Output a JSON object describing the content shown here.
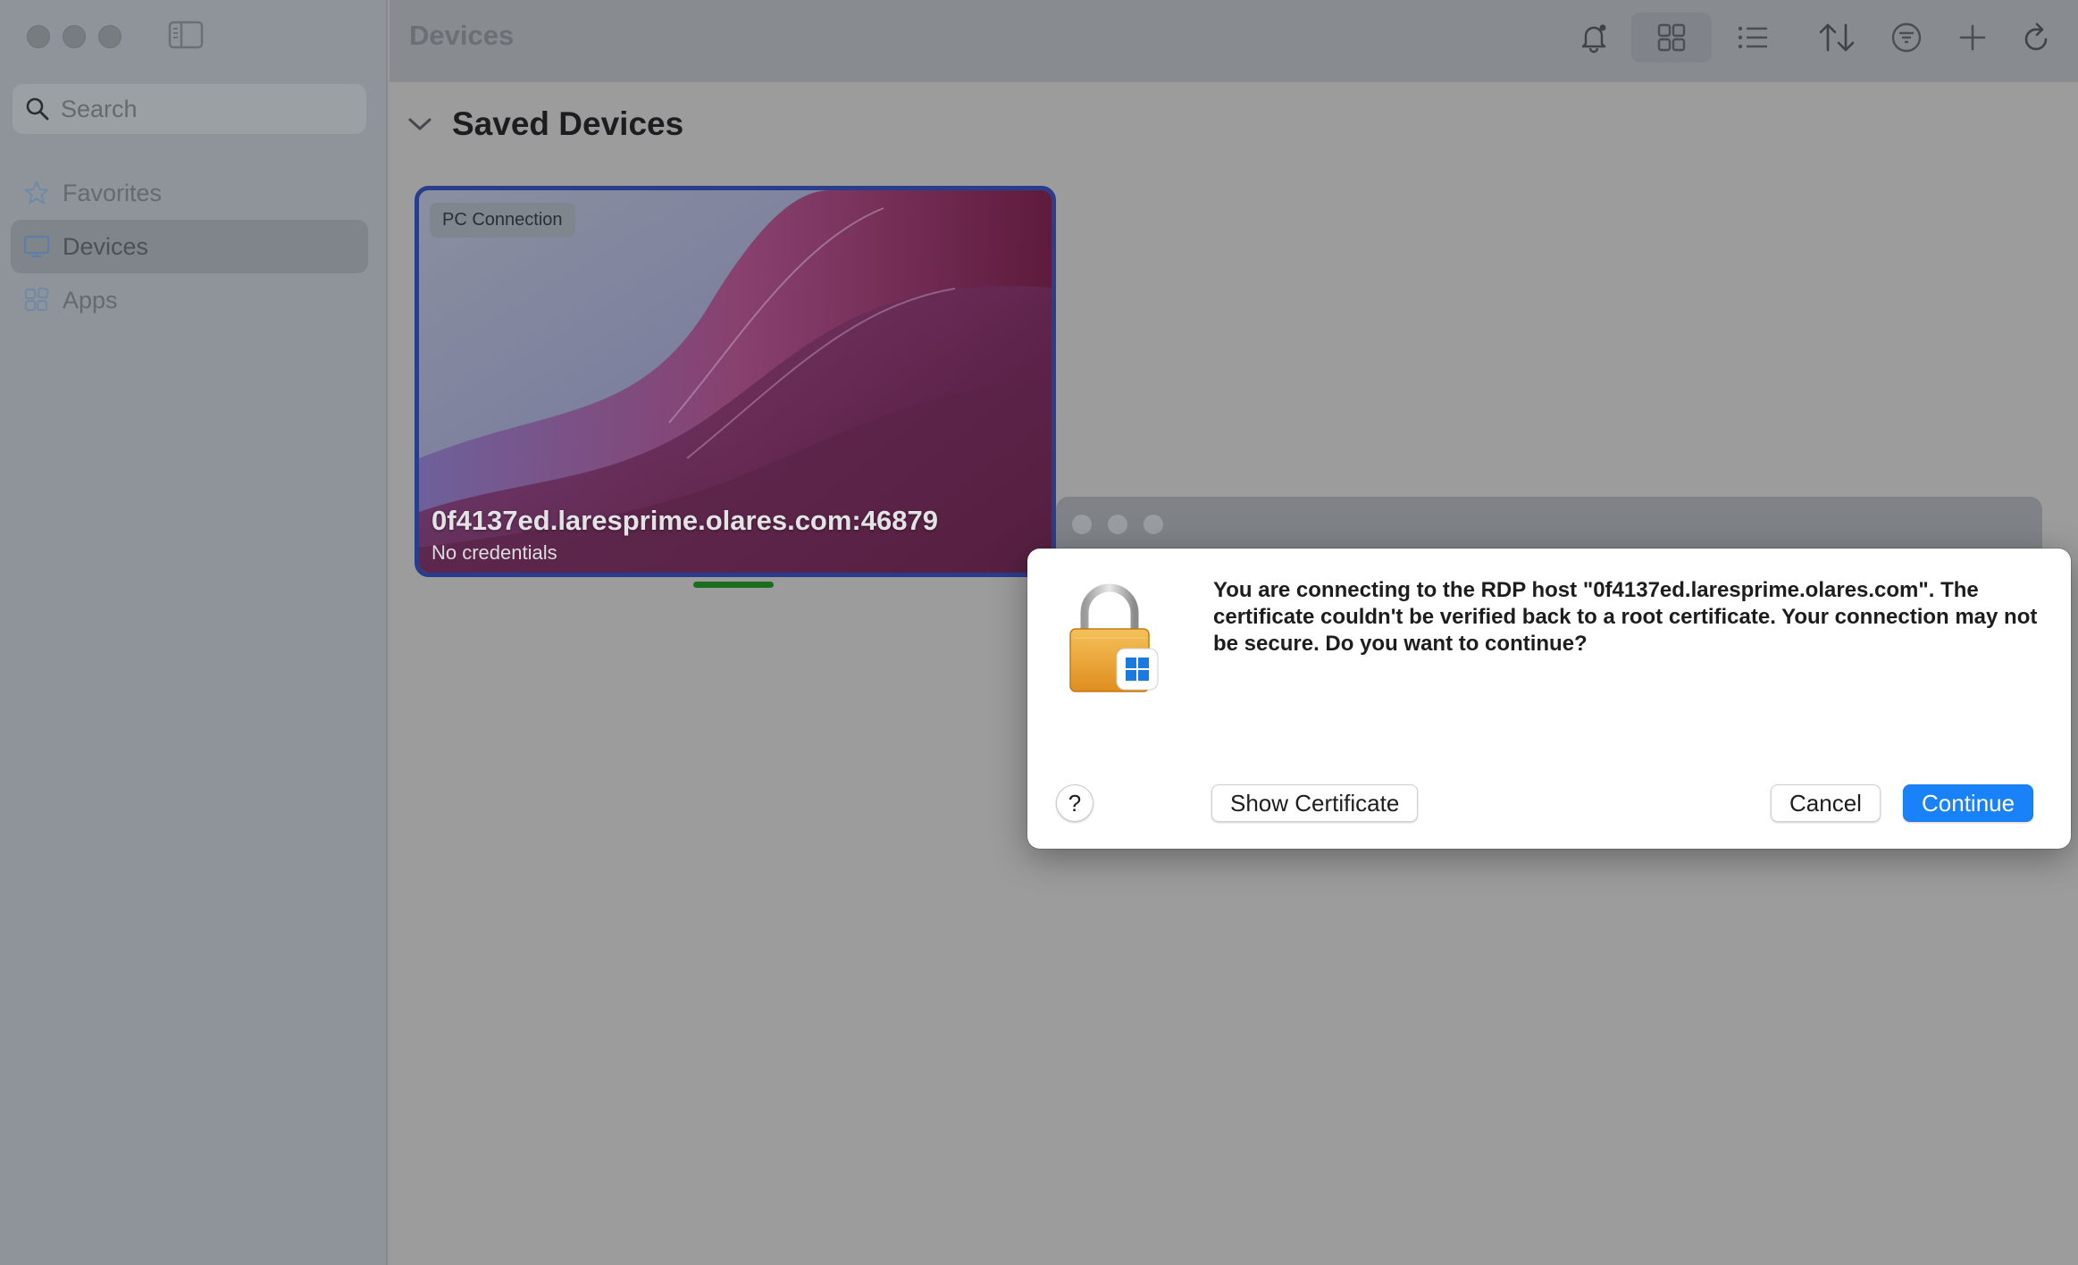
{
  "window": {
    "title": "Devices"
  },
  "sidebar": {
    "search_placeholder": "Search",
    "items": [
      {
        "label": "Favorites",
        "icon": "star-icon",
        "active": false
      },
      {
        "label": "Devices",
        "icon": "monitor-icon",
        "active": true
      },
      {
        "label": "Apps",
        "icon": "apps-icon",
        "active": false
      }
    ]
  },
  "toolbar": {
    "title": "Devices",
    "icons": [
      "bell-icon",
      "grid-view-icon",
      "list-view-icon",
      "sort-icon",
      "filter-icon",
      "add-icon",
      "refresh-icon"
    ]
  },
  "main": {
    "section_title": "Saved Devices",
    "card": {
      "badge": "PC Connection",
      "host": "0f4137ed.laresprime.olares.com:46879",
      "subtitle": "No credentials"
    }
  },
  "dialog": {
    "message": "You are connecting to the RDP host \"0f4137ed.laresprime.olares.com\". The certificate couldn't be verified back to a root certificate. Your connection may not be secure. Do you want to continue?",
    "help_label": "?",
    "show_certificate_label": "Show Certificate",
    "cancel_label": "Cancel",
    "continue_label": "Continue"
  },
  "colors": {
    "accent": "#1a82f8",
    "card_border": "#2a3d8c",
    "status_green": "#1b6e1f"
  }
}
